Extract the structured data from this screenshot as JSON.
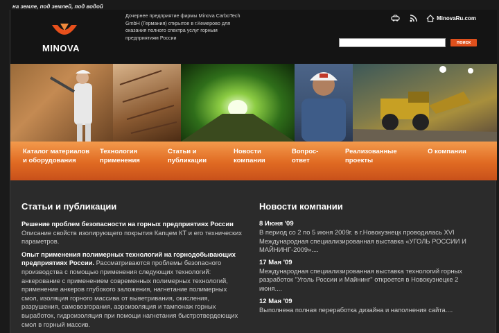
{
  "tagline": "на земле, под землей, под водой",
  "logo": {
    "text": "MINOVA",
    "accent": "#e8501c"
  },
  "about": "Дочернее предприятие фирмы Minova CarboTech GmbH (Германия) открытое в г.Кемерово для оказания полного спектра услуг горным предприятиям России",
  "toplinks": {
    "site": "MinovaRu.com",
    "icons": [
      "sitemap-icon",
      "rss-icon",
      "home-icon"
    ]
  },
  "search": {
    "placeholder": "",
    "button": "поиск"
  },
  "menu": [
    {
      "label": "Каталог материалов и оборудования"
    },
    {
      "label": "Технология применения"
    },
    {
      "label": "Статьи и публикации"
    },
    {
      "label": "Новости компании"
    },
    {
      "label": "Вопрос-ответ"
    },
    {
      "label": "Реализованные проекты"
    },
    {
      "label": "О компании"
    }
  ],
  "articles": {
    "title": "Статьи и публикации",
    "items": [
      {
        "title": "Решение проблем безопасности на горных предприятиях России",
        "text": " Описание свойств изолирующего покрытия Капцем КТ и его технических параметров."
      },
      {
        "title": "Опыт применения полимерных технологий на горнодобывающих предприятиях России.",
        "text": " Рассматриваются проблемы безопасного производства с помощью применения следующих технологий: анкерование с применением современных полимерных технологий, применение анкеров глубокого заложения, нагнетание полимерных смол, изоляция горного массива от выветривания, окисления, разрушения, самовозгорания, аэроизоляция и тампонаж горных выработок, гидроизоляция при помощи нагнетания быстротвердеющих смол в горный массив."
      }
    ]
  },
  "news": {
    "title": "Новости компании",
    "items": [
      {
        "date": "8 Июня '09",
        "text": "В период со 2 по 5 июня 2009г. в г.Новокузнецк проводилась XVI Международная специализированная выставка «УГОЛЬ РОССИИ И МАЙНИНГ-2009»...."
      },
      {
        "date": "17 Мая '09",
        "text": "Международная специализированная выставка технологий горных разработок \"Уголь России и Майнинг\" откроется в Новокузнецке 2 июня...."
      },
      {
        "date": "12 Мая '09",
        "text": "Выполнена полная переработка дизайна и наполнения сайта...."
      }
    ]
  }
}
